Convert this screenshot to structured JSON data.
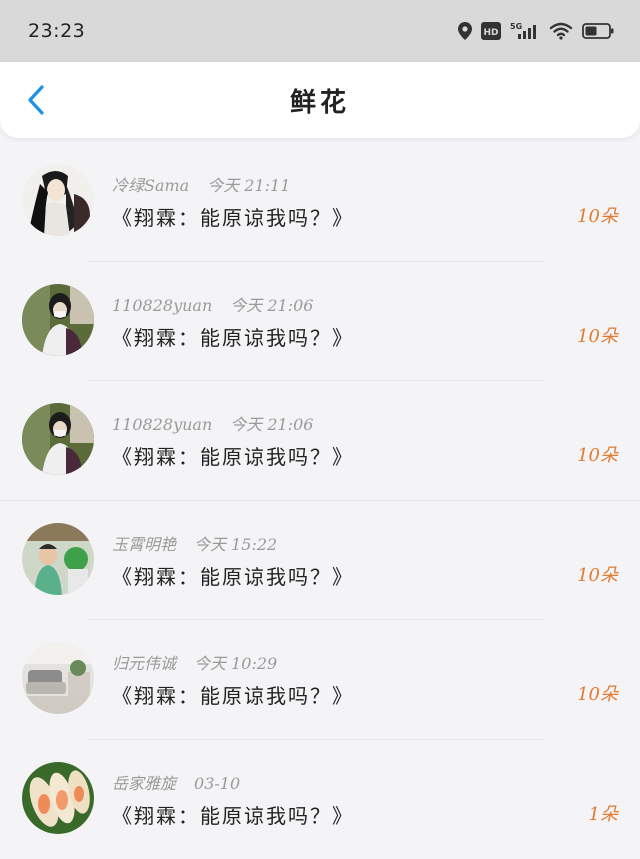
{
  "status": {
    "time": "23:23",
    "hd": "HD",
    "network": "5G"
  },
  "header": {
    "title": "鲜花"
  },
  "colors": {
    "accent": "#1e90e6",
    "count": "#e27a30"
  },
  "items": [
    {
      "user": "冷绿Sama",
      "time": "今天 21:11",
      "message": "《翔霖：能原谅我吗？》",
      "count": "10朵",
      "avatar": "ink-painting-swordsman"
    },
    {
      "user": "110828yuan",
      "time": "今天 21:06",
      "message": "《翔霖：能原谅我吗？》",
      "count": "10朵",
      "avatar": "girl-with-backpack"
    },
    {
      "user": "110828yuan",
      "time": "今天 21:06",
      "message": "《翔霖：能原谅我吗？》",
      "count": "10朵",
      "avatar": "girl-with-backpack"
    },
    {
      "user": "玉霄明艳",
      "time": "今天 15:22",
      "message": "《翔霖：能原谅我吗？》",
      "count": "10朵",
      "avatar": "boy-in-room"
    },
    {
      "user": "归元伟诚",
      "time": "今天 10:29",
      "message": "《翔霖：能原谅我吗？》",
      "count": "10朵",
      "avatar": "living-room"
    },
    {
      "user": "岳家雅旋",
      "time": "03-10",
      "message": "《翔霖：能原谅我吗？》",
      "count": "1朵",
      "avatar": "spring-rolls"
    }
  ]
}
